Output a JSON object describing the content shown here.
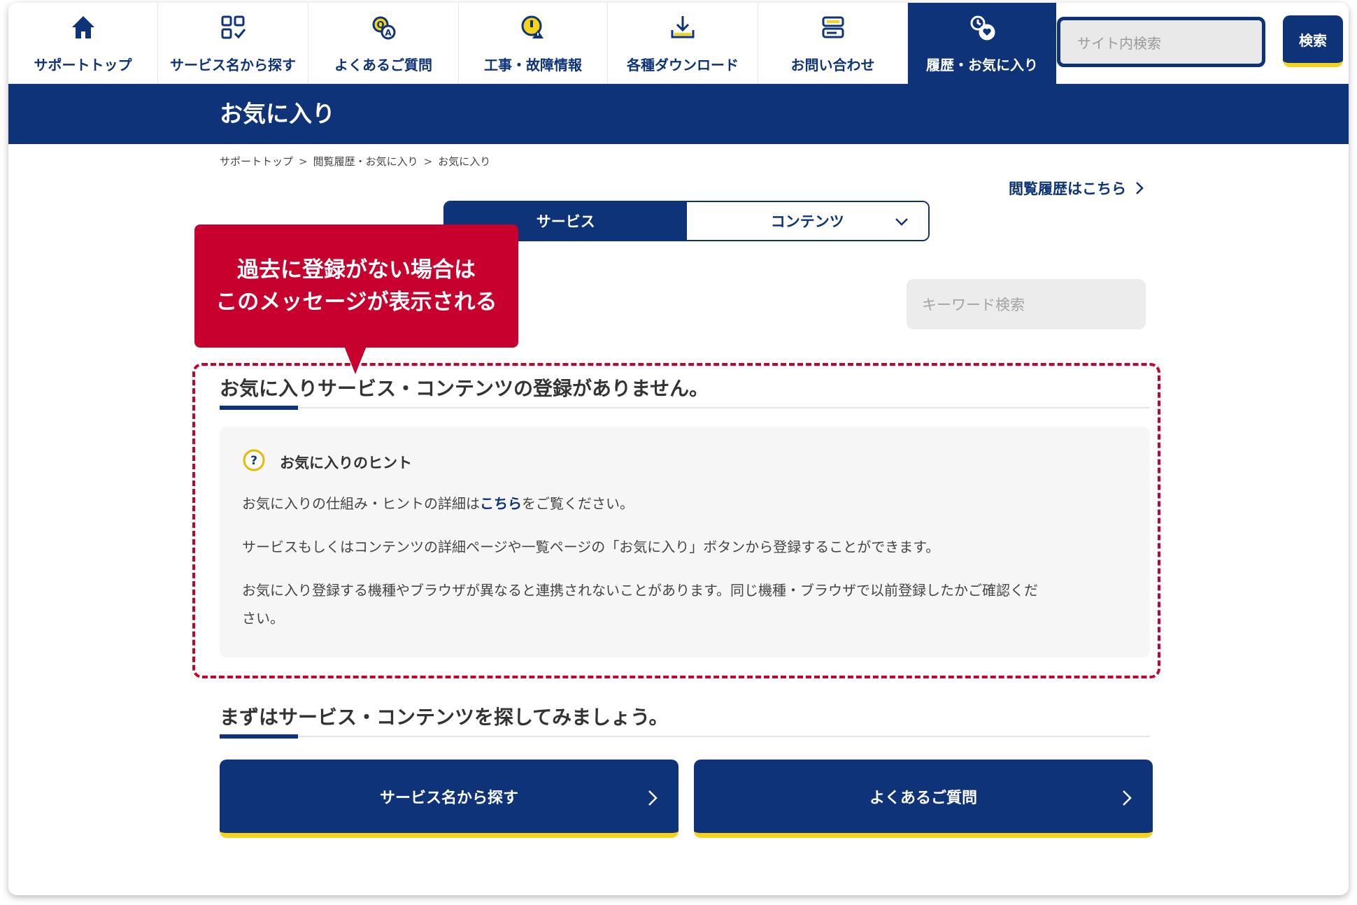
{
  "nav": {
    "items": [
      {
        "label": "サポートトップ",
        "icon": "home-icon",
        "active": false
      },
      {
        "label": "サービス名から探す",
        "icon": "grid-check-icon",
        "active": false
      },
      {
        "label": "よくあるご質問",
        "icon": "faq-icon",
        "active": false
      },
      {
        "label": "工事・故障情報",
        "icon": "construction-info-icon",
        "active": false
      },
      {
        "label": "各種ダウンロード",
        "icon": "download-icon",
        "active": false
      },
      {
        "label": "お問い合わせ",
        "icon": "contact-icon",
        "active": false
      },
      {
        "label": "履歴・お気に入り",
        "icon": "history-favorite-icon",
        "active": true
      }
    ],
    "search_placeholder": "サイト内検索",
    "search_button": "検索"
  },
  "banner": {
    "title": "お気に入り"
  },
  "breadcrumb": [
    "サポートトップ",
    "閲覧履歴・お気に入り",
    "お気に入り"
  ],
  "history_link": "閲覧履歴はこちら",
  "tabs": [
    {
      "label": "サービス",
      "active": true
    },
    {
      "label": "コンテンツ",
      "active": false
    }
  ],
  "keyword_placeholder": "キーワード検索",
  "callout": {
    "line1": "過去に登録がない場合は",
    "line2": "このメッセージが表示される"
  },
  "empty": {
    "title": "お気に入りサービス・コンテンツの登録がありません。"
  },
  "hint": {
    "title": "お気に入りのヒント",
    "p1_before": "お気に入りの仕組み・ヒントの詳細は",
    "p1_link": "こちら",
    "p1_after": "をご覧ください。",
    "p2": "サービスもしくはコンテンツの詳細ページや一覧ページの「お気に入り」ボタンから登録することができます。",
    "p3_line1": "お気に入り登録する機種やブラウザが異なると連携されないことがあります。同じ機種・ブラウザで以前登録したかご確認くだ",
    "p3_line2": "さい。"
  },
  "find": {
    "title": "まずはサービス・コンテンツを探してみましょう。",
    "buttons": [
      "サービス名から探す",
      "よくあるご質問"
    ]
  },
  "colors": {
    "navy": "#0f3379",
    "accent_yellow": "#f5d31a",
    "callout_red": "#c8002d",
    "hint_icon": "#e9b800"
  }
}
